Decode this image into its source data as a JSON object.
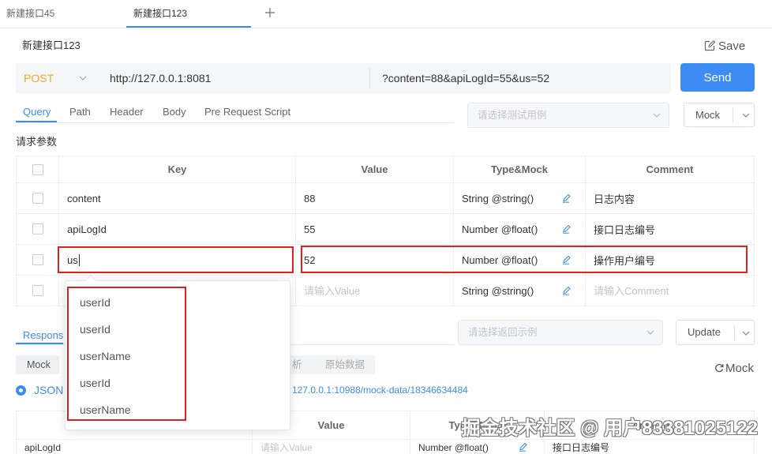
{
  "colors": {
    "accent": "#3c8cf4",
    "method_post": "#f5a623",
    "highlight_box": "#e02020",
    "placeholder": "#c0c4cc"
  },
  "tabs": [
    {
      "label": "新建接口45",
      "active": false
    },
    {
      "label": "新建接口123",
      "active": true
    }
  ],
  "header": {
    "api_name": "新建接口123",
    "save_label": "Save",
    "save_icon": "edit-icon",
    "add_tab_icon": "plus-icon"
  },
  "request": {
    "method": "POST",
    "url": "http://127.0.0.1:8081",
    "query": "?content=88&apiLogId=55&us=52",
    "send_label": "Send"
  },
  "request_tabs": [
    {
      "label": "Query",
      "active": true
    },
    {
      "label": "Path"
    },
    {
      "label": "Header"
    },
    {
      "label": "Body"
    },
    {
      "label": "Pre Request Script"
    }
  ],
  "test_case_select": {
    "placeholder": "请选择测试用例"
  },
  "mock_menu": {
    "label": "Mock"
  },
  "params": {
    "title": "请求参数",
    "columns": [
      "Key",
      "Value",
      "Type&Mock",
      "Comment"
    ],
    "rows": [
      {
        "key": "content",
        "value": "88",
        "type": "String @string()",
        "comment": "日志内容"
      },
      {
        "key": "apiLogId",
        "value": "55",
        "type": "Number @float()",
        "comment": "接口日志编号"
      },
      {
        "key": "us",
        "value": "52",
        "type": "Number @float()",
        "comment": "操作用户编号",
        "editing": true
      },
      {
        "value_placeholder": "请输入Value",
        "type": "String @string()",
        "comment_placeholder": "请输入Comment"
      }
    ]
  },
  "autocomplete": {
    "options": [
      "userId",
      "userId",
      "userName",
      "userId",
      "userName"
    ]
  },
  "response": {
    "tab_label": "Respons",
    "example_select": {
      "placeholder": "请选择返回示例"
    },
    "update_menu": {
      "label": "Update"
    },
    "view_buttons": [
      "Mock",
      "析",
      "原始数据"
    ],
    "refresh_mock_label": "Mock",
    "format": {
      "label": "JSON",
      "selected": true
    },
    "mock_url": "127.0.0.1:10988/mock-data/18346634484",
    "columns": [
      "Value",
      "Type&Mock",
      "Comment"
    ],
    "rows": [
      {
        "key": "apiLogId",
        "value_placeholder": "请输入Value",
        "type": "Number @float()",
        "comment": "接口日志编号"
      }
    ]
  },
  "watermark": "掘金技术社区 @ 用户83381025122"
}
